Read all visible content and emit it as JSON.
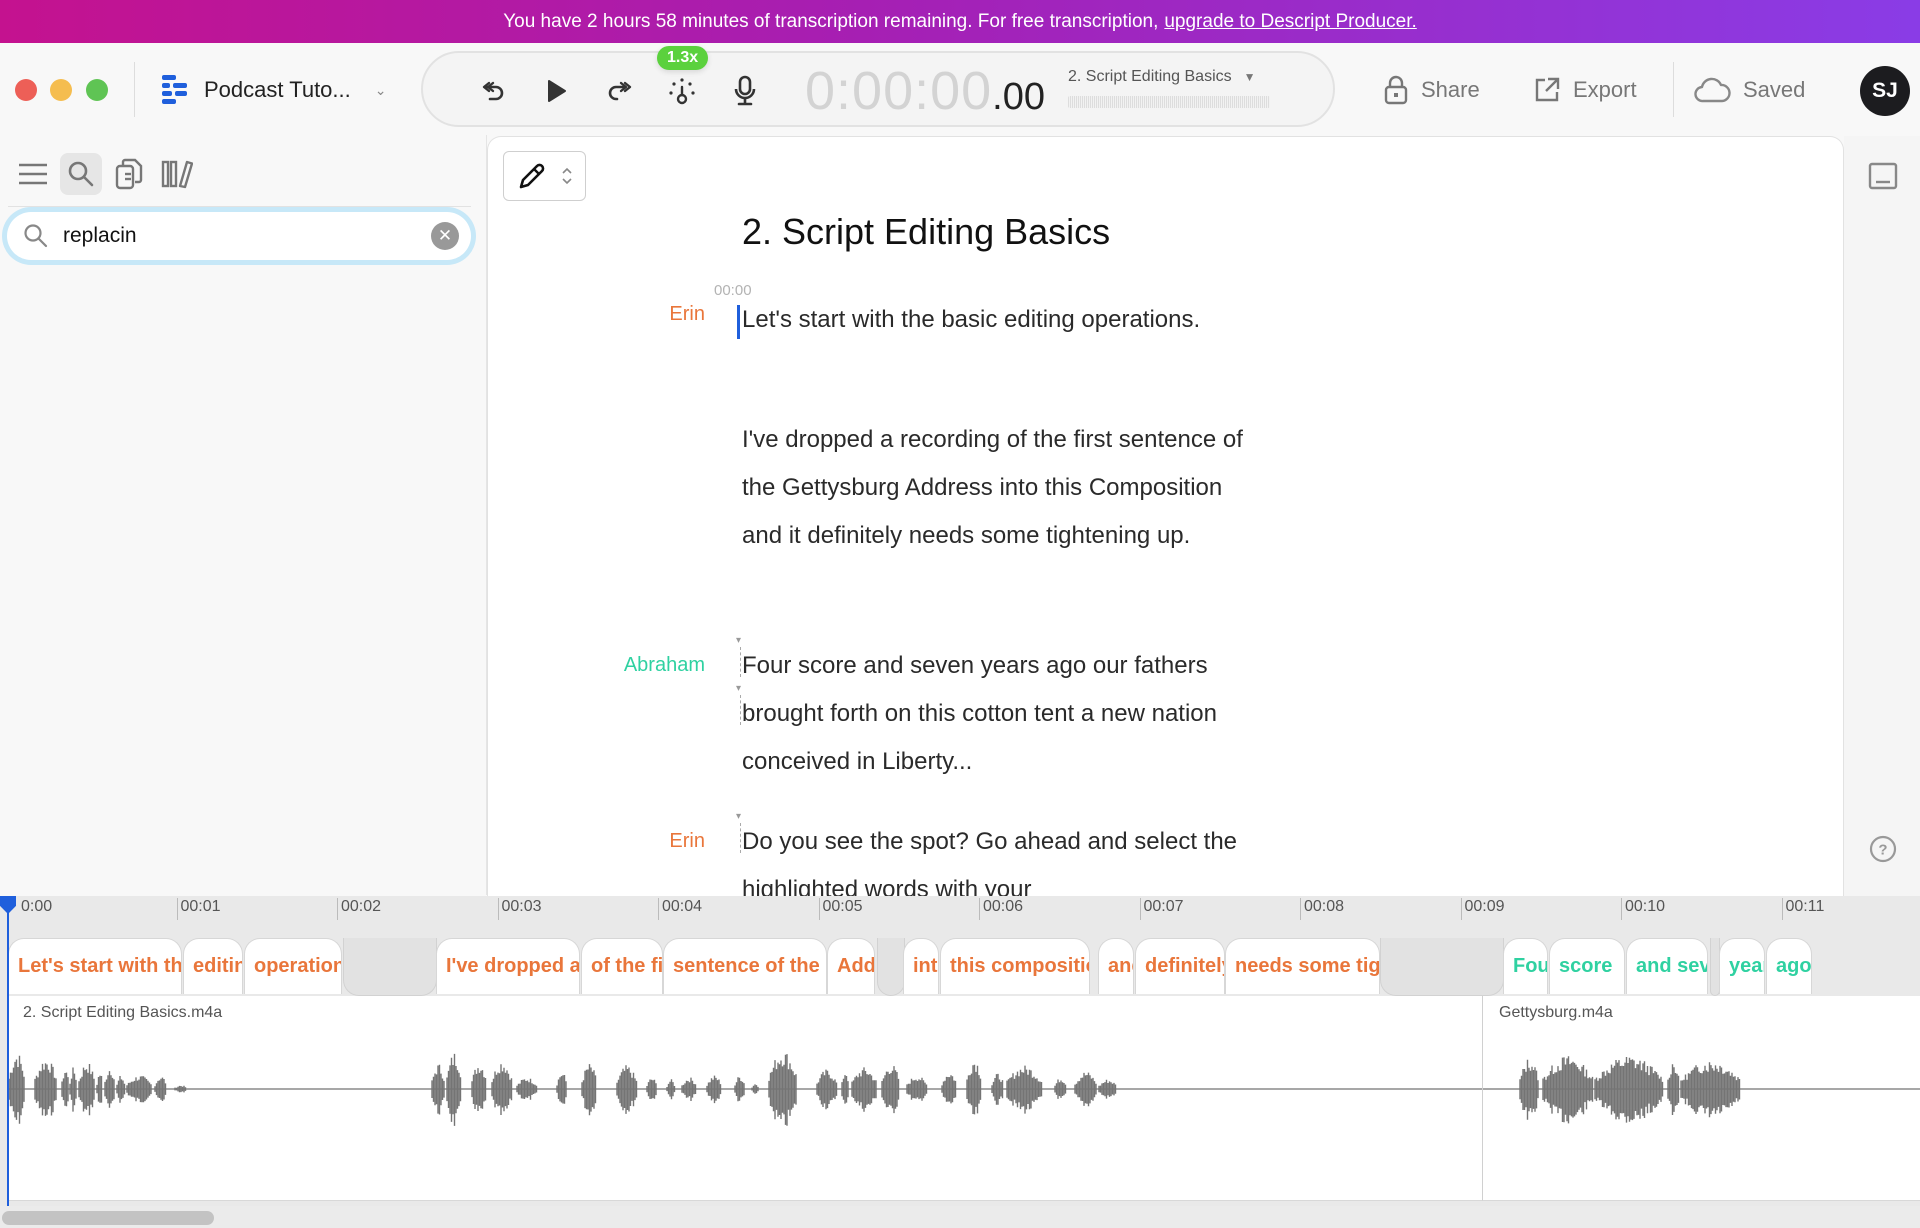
{
  "banner": {
    "message": "You have 2 hours 58 minutes of transcription remaining. For free transcription,",
    "link_text": "upgrade to Descript Producer."
  },
  "window": {
    "controls": [
      "close",
      "minimize",
      "zoom"
    ]
  },
  "toolbar": {
    "project_title": "Podcast Tuto...",
    "playback_speed": "1.3x",
    "timecode_main": "0:00:00",
    "timecode_fraction": ".00",
    "composition": "2. Script Editing Basics",
    "share_label": "Share",
    "export_label": "Export",
    "saved_label": "Saved",
    "avatar_initials": "SJ",
    "icons": [
      "descript-logo-icon",
      "rewind-icon",
      "play-icon",
      "forward-icon",
      "speed-icon",
      "microphone-icon",
      "lock-icon",
      "export-icon",
      "cloud-icon"
    ]
  },
  "left_panel": {
    "tabs": [
      {
        "name": "menu",
        "active": false
      },
      {
        "name": "search",
        "active": true
      },
      {
        "name": "compositions",
        "active": false
      },
      {
        "name": "library",
        "active": false
      }
    ],
    "search": {
      "value": "replacin",
      "placeholder": "Search"
    }
  },
  "editor": {
    "title": "2. Script Editing Basics",
    "start_timestamp": "00:00",
    "paragraphs": [
      {
        "speaker": "Erin",
        "text": "Let's start with the basic editing operations."
      },
      {
        "speaker": "",
        "text": "I've dropped a recording of the first sentence of the Gettysburg Address into this Composition and it definitely needs some tightening up."
      },
      {
        "speaker": "Abraham",
        "text": "Four score and seven years ago our fathers brought forth on this cotton tent a new nation conceived in Liberty..."
      },
      {
        "speaker": "Erin",
        "text": "Do you see the spot? Go ahead and select the highlighted words with your"
      }
    ],
    "speaker_colors": {
      "Erin": "#e9763b",
      "Abraham": "#2fd1a1"
    }
  },
  "timeline": {
    "ticks": [
      "0:00",
      "00:01",
      "00:02",
      "00:03",
      "00:04",
      "00:05",
      "00:06",
      "00:07",
      "00:08",
      "00:09",
      "00:10",
      "00:11"
    ],
    "words": [
      {
        "text": "Let's start with the",
        "speaker": "Erin"
      },
      {
        "text": "editing",
        "speaker": "Erin"
      },
      {
        "text": "operations.",
        "speaker": "Erin"
      },
      {
        "text": "I've dropped a",
        "speaker": "Erin"
      },
      {
        "text": "of the first",
        "speaker": "Erin"
      },
      {
        "text": "sentence of the",
        "speaker": "Erin"
      },
      {
        "text": "Address",
        "speaker": "Erin"
      },
      {
        "text": "into",
        "speaker": "Erin"
      },
      {
        "text": "this composition",
        "speaker": "Erin"
      },
      {
        "text": "and",
        "speaker": "Erin"
      },
      {
        "text": "definitely",
        "speaker": "Erin"
      },
      {
        "text": "needs some tightening",
        "speaker": "Erin"
      },
      {
        "text": "Four",
        "speaker": "Abraham"
      },
      {
        "text": "score",
        "speaker": "Abraham"
      },
      {
        "text": "and seven",
        "speaker": "Abraham"
      },
      {
        "text": "years",
        "speaker": "Abraham"
      },
      {
        "text": "ago",
        "speaker": "Abraham"
      }
    ],
    "tracks": [
      {
        "label": "2. Script Editing Basics.m4a"
      },
      {
        "label": "Gettysburg.m4a"
      }
    ]
  },
  "right_rail": {
    "icons": [
      "panel-toggle-icon",
      "help-icon"
    ]
  }
}
